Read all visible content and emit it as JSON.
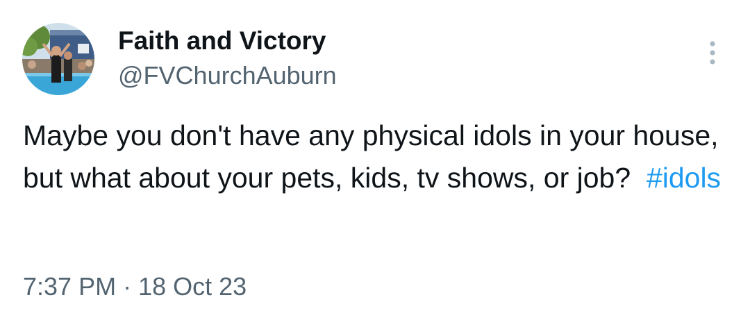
{
  "tweet": {
    "author": {
      "display_name": "Faith and Victory",
      "handle": "@FVChurchAuburn",
      "avatar_icon": "avatar-photo"
    },
    "more_icon": "more-vertical-icon",
    "text_before": "Maybe you don't have any physical idols in your house, but what about your pets, kids, tv shows, or job?",
    "hashtag": "#idols",
    "hashtag_color": "#1d9bf0",
    "time": "7:37 PM",
    "separator": "·",
    "date": "18 Oct 23"
  }
}
